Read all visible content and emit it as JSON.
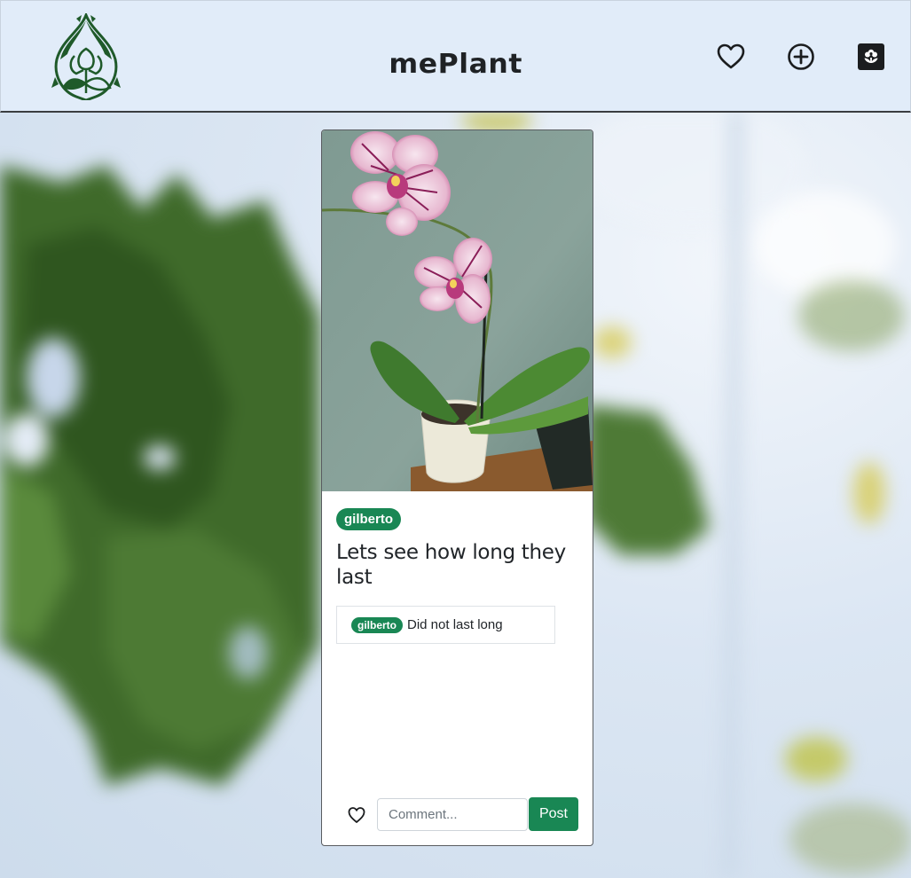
{
  "app": {
    "brand": "mePlant"
  },
  "header": {
    "logo_icon": "lotus-leaf-logo-icon",
    "nav_icons": [
      "heart-icon",
      "plus-circle-icon",
      "flower-square-icon"
    ]
  },
  "post": {
    "image_alt": "Pink striped orchid in white pot",
    "author": "gilberto",
    "title": "Lets see how long they last",
    "comments": [
      {
        "author": "gilberto",
        "text": "Did not last long"
      }
    ]
  },
  "actions": {
    "like_icon": "heart-icon",
    "comment_placeholder": "Comment...",
    "post_label": "Post"
  },
  "colors": {
    "accent_green": "#198754",
    "header_bg": "#e1ecf9",
    "logo_green": "#1f5a2a"
  }
}
